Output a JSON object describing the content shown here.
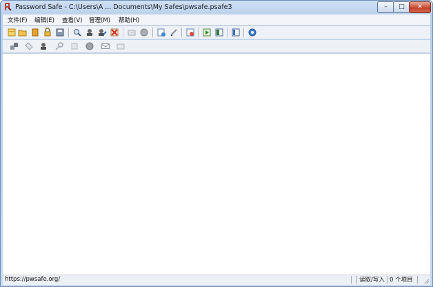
{
  "window": {
    "title": "Password Safe - C:\\Users\\A ... Documents\\My Safes\\pwsafe.psafe3",
    "controls": {
      "minimize": "–",
      "maximize": "□",
      "close": "✕"
    }
  },
  "menu": {
    "items": [
      "文件(F)",
      "编辑(E)",
      "查看(V)",
      "管理(M)",
      "帮助(H)"
    ]
  },
  "toolbar_main": {
    "icons": [
      "new-database-icon",
      "open-database-icon",
      "close-database-icon",
      "lock-database-icon",
      "save-icon",
      "find-icon",
      "add-entry-icon",
      "edit-entry-icon",
      "delete-entry-icon",
      "copy-password-icon",
      "clear-clipboard-icon",
      "browse-url-icon",
      "autotype-icon",
      "expand-all-icon",
      "collapse-all-icon",
      "options-icon",
      "help-icon"
    ]
  },
  "toolbar_entry": {
    "icons": [
      "add-group-icon",
      "tag-icon",
      "users-icon",
      "key-icon",
      "note-icon",
      "globe-icon",
      "email-icon",
      "run-command-icon"
    ]
  },
  "status": {
    "url": "https://pwsafe.org/",
    "mode": "读取/写入",
    "count": "0 个项目"
  },
  "colors": {
    "frame": "#b9d0ec",
    "close_button": "#c5422b",
    "content_bg": "#ffffff"
  }
}
